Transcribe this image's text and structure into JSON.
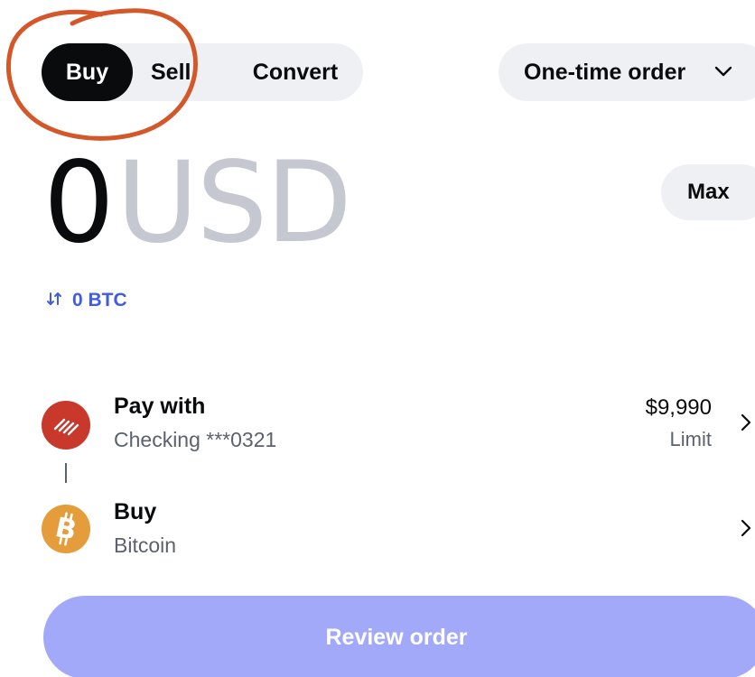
{
  "tabs": {
    "buy": "Buy",
    "sell": "Sell",
    "convert": "Convert"
  },
  "order_type": {
    "label": "One-time order",
    "icon": "chevron-down-icon"
  },
  "amount": {
    "value": "0",
    "currency": "USD"
  },
  "max_button": {
    "label": "Max"
  },
  "conversion": {
    "icon": "swap-arrows-icon",
    "label": "0 BTC"
  },
  "pay_with": {
    "icon": "bank-logo-icon",
    "title": "Pay with",
    "subtitle": "Checking ***0321",
    "amount": "$9,990",
    "amount_label": "Limit"
  },
  "buy_asset": {
    "icon": "bitcoin-icon",
    "title": "Buy",
    "subtitle": "Bitcoin"
  },
  "review_button": {
    "label": "Review order"
  },
  "colors": {
    "accent": "#3f5be8",
    "review_button": "#a3a9f9",
    "annotation": "#d4572a",
    "bank": "#c8382b",
    "bitcoin": "#e59c3a"
  }
}
